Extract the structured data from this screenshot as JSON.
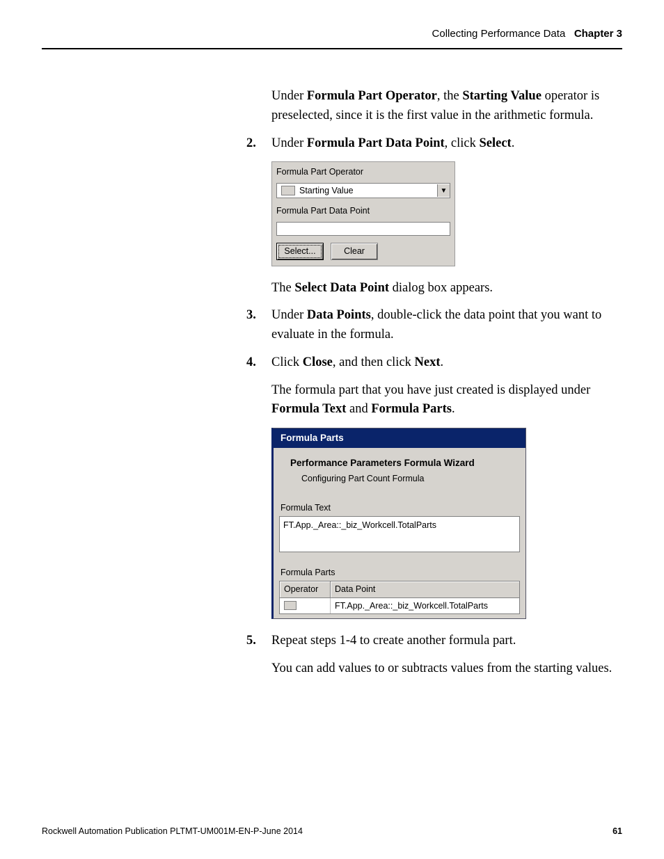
{
  "header": {
    "section": "Collecting Performance Data",
    "chapter": "Chapter 3"
  },
  "body": {
    "p1_pre": "Under ",
    "p1_b1": "Formula Part Operator",
    "p1_mid": ", the ",
    "p1_b2": "Starting Value",
    "p1_post": " operator is preselected, since it is the first value in the arithmetic formula.",
    "step2_num": "2.",
    "step2_pre": "Under ",
    "step2_b1": "Formula Part Data Point",
    "step2_mid": ", click ",
    "step2_b2": "Select",
    "step2_post": ".",
    "p2_pre": "The ",
    "p2_b1": "Select Data Point",
    "p2_post": " dialog box appears.",
    "step3_num": "3.",
    "step3_pre": "Under ",
    "step3_b1": "Data Points",
    "step3_post": ", double-click the data point that you want to evaluate in the formula.",
    "step4_num": "4.",
    "step4_pre": "Click ",
    "step4_b1": "Close",
    "step4_mid": ", and then click ",
    "step4_b2": "Next",
    "step4_post": ".",
    "p3_pre": "The formula part that you have just created is displayed under ",
    "p3_b1": "Formula Text",
    "p3_mid": " and ",
    "p3_b2": "Formula Parts",
    "p3_post": ".",
    "step5_num": "5.",
    "step5_txt": "Repeat steps 1-4 to create another formula part.",
    "p4_txt": "You can add values to or subtracts values from the starting values."
  },
  "fig1": {
    "label_operator": "Formula Part Operator",
    "combo_value": "Starting Value",
    "label_datapoint": "Formula Part Data Point",
    "btn_select": "Select...",
    "btn_clear": "Clear"
  },
  "fig2": {
    "title": "Formula Parts",
    "wiz_title": "Performance Parameters Formula Wizard",
    "wiz_sub": "Configuring Part Count Formula",
    "label_ftext": "Formula Text",
    "ftext_value": "FT.App._Area::_biz_Workcell.TotalParts",
    "label_fparts": "Formula Parts",
    "col_operator": "Operator",
    "col_datapoint": "Data Point",
    "row_datapoint": "FT.App._Area::_biz_Workcell.TotalParts"
  },
  "footer": {
    "pub": "Rockwell Automation Publication PLTMT-UM001M-EN-P-June 2014",
    "page": "61"
  }
}
